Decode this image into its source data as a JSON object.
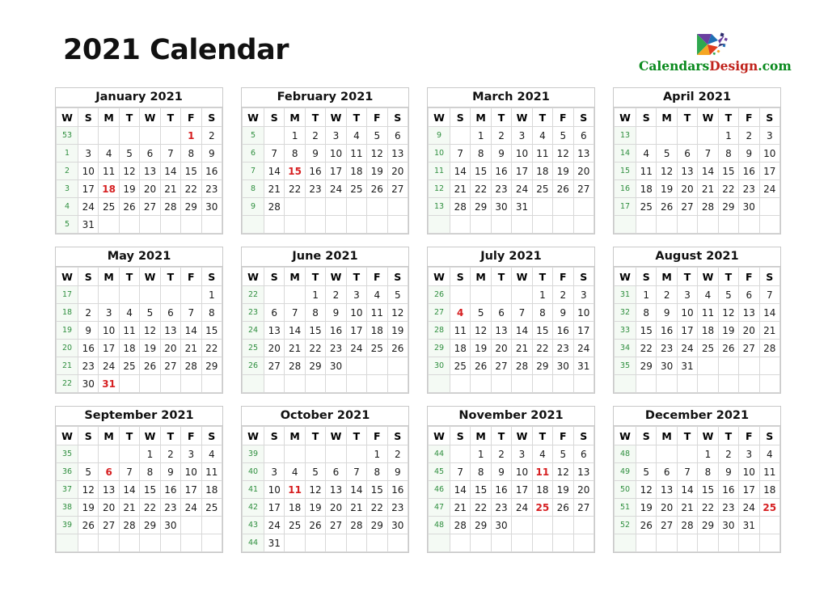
{
  "header": {
    "title": "2021 Calendar",
    "brand": {
      "part1": "Calendars",
      "part2": "Design",
      "part3": ".com",
      "logo_icon": "pinwheel-logo-icon"
    }
  },
  "colors": {
    "holiday": "#d61f21",
    "week_number": "#2f8f3f",
    "week_cell_bg": "#f4faf4",
    "border": "#c9c9c9",
    "text": "#1a1a1a",
    "brand_green": "#0a8a1e",
    "brand_red": "#c0231c"
  },
  "weekday_headers": [
    "W",
    "S",
    "M",
    "T",
    "W",
    "T",
    "F",
    "S"
  ],
  "months": [
    {
      "name": "January 2021",
      "weeks": [
        {
          "no": "53",
          "days": [
            "",
            "",
            "",
            "",
            "",
            "1",
            "2"
          ],
          "holidays": [
            "1"
          ]
        },
        {
          "no": "1",
          "days": [
            "3",
            "4",
            "5",
            "6",
            "7",
            "8",
            "9"
          ],
          "holidays": []
        },
        {
          "no": "2",
          "days": [
            "10",
            "11",
            "12",
            "13",
            "14",
            "15",
            "16"
          ],
          "holidays": []
        },
        {
          "no": "3",
          "days": [
            "17",
            "18",
            "19",
            "20",
            "21",
            "22",
            "23"
          ],
          "holidays": [
            "18"
          ]
        },
        {
          "no": "4",
          "days": [
            "24",
            "25",
            "26",
            "27",
            "28",
            "29",
            "30"
          ],
          "holidays": []
        },
        {
          "no": "5",
          "days": [
            "31",
            "",
            "",
            "",
            "",
            "",
            ""
          ],
          "holidays": []
        }
      ]
    },
    {
      "name": "February 2021",
      "weeks": [
        {
          "no": "5",
          "days": [
            "",
            "1",
            "2",
            "3",
            "4",
            "5",
            "6"
          ],
          "holidays": []
        },
        {
          "no": "6",
          "days": [
            "7",
            "8",
            "9",
            "10",
            "11",
            "12",
            "13"
          ],
          "holidays": []
        },
        {
          "no": "7",
          "days": [
            "14",
            "15",
            "16",
            "17",
            "18",
            "19",
            "20"
          ],
          "holidays": [
            "15"
          ]
        },
        {
          "no": "8",
          "days": [
            "21",
            "22",
            "23",
            "24",
            "25",
            "26",
            "27"
          ],
          "holidays": []
        },
        {
          "no": "9",
          "days": [
            "28",
            "",
            "",
            "",
            "",
            "",
            ""
          ],
          "holidays": []
        },
        {
          "no": "",
          "days": [
            "",
            "",
            "",
            "",
            "",
            "",
            ""
          ],
          "holidays": []
        }
      ]
    },
    {
      "name": "March 2021",
      "weeks": [
        {
          "no": "9",
          "days": [
            "",
            "1",
            "2",
            "3",
            "4",
            "5",
            "6"
          ],
          "holidays": []
        },
        {
          "no": "10",
          "days": [
            "7",
            "8",
            "9",
            "10",
            "11",
            "12",
            "13"
          ],
          "holidays": []
        },
        {
          "no": "11",
          "days": [
            "14",
            "15",
            "16",
            "17",
            "18",
            "19",
            "20"
          ],
          "holidays": []
        },
        {
          "no": "12",
          "days": [
            "21",
            "22",
            "23",
            "24",
            "25",
            "26",
            "27"
          ],
          "holidays": []
        },
        {
          "no": "13",
          "days": [
            "28",
            "29",
            "30",
            "31",
            "",
            "",
            ""
          ],
          "holidays": []
        },
        {
          "no": "",
          "days": [
            "",
            "",
            "",
            "",
            "",
            "",
            ""
          ],
          "holidays": []
        }
      ]
    },
    {
      "name": "April 2021",
      "weeks": [
        {
          "no": "13",
          "days": [
            "",
            "",
            "",
            "",
            "1",
            "2",
            "3"
          ],
          "holidays": []
        },
        {
          "no": "14",
          "days": [
            "4",
            "5",
            "6",
            "7",
            "8",
            "9",
            "10"
          ],
          "holidays": []
        },
        {
          "no": "15",
          "days": [
            "11",
            "12",
            "13",
            "14",
            "15",
            "16",
            "17"
          ],
          "holidays": []
        },
        {
          "no": "16",
          "days": [
            "18",
            "19",
            "20",
            "21",
            "22",
            "23",
            "24"
          ],
          "holidays": []
        },
        {
          "no": "17",
          "days": [
            "25",
            "26",
            "27",
            "28",
            "29",
            "30",
            ""
          ],
          "holidays": []
        },
        {
          "no": "",
          "days": [
            "",
            "",
            "",
            "",
            "",
            "",
            ""
          ],
          "holidays": []
        }
      ]
    },
    {
      "name": "May 2021",
      "weeks": [
        {
          "no": "17",
          "days": [
            "",
            "",
            "",
            "",
            "",
            "",
            "1"
          ],
          "holidays": []
        },
        {
          "no": "18",
          "days": [
            "2",
            "3",
            "4",
            "5",
            "6",
            "7",
            "8"
          ],
          "holidays": []
        },
        {
          "no": "19",
          "days": [
            "9",
            "10",
            "11",
            "12",
            "13",
            "14",
            "15"
          ],
          "holidays": []
        },
        {
          "no": "20",
          "days": [
            "16",
            "17",
            "18",
            "19",
            "20",
            "21",
            "22"
          ],
          "holidays": []
        },
        {
          "no": "21",
          "days": [
            "23",
            "24",
            "25",
            "26",
            "27",
            "28",
            "29"
          ],
          "holidays": []
        },
        {
          "no": "22",
          "days": [
            "30",
            "31",
            "",
            "",
            "",
            "",
            ""
          ],
          "holidays": [
            "31"
          ]
        }
      ]
    },
    {
      "name": "June 2021",
      "weeks": [
        {
          "no": "22",
          "days": [
            "",
            "",
            "1",
            "2",
            "3",
            "4",
            "5"
          ],
          "holidays": []
        },
        {
          "no": "23",
          "days": [
            "6",
            "7",
            "8",
            "9",
            "10",
            "11",
            "12"
          ],
          "holidays": []
        },
        {
          "no": "24",
          "days": [
            "13",
            "14",
            "15",
            "16",
            "17",
            "18",
            "19"
          ],
          "holidays": []
        },
        {
          "no": "25",
          "days": [
            "20",
            "21",
            "22",
            "23",
            "24",
            "25",
            "26"
          ],
          "holidays": []
        },
        {
          "no": "26",
          "days": [
            "27",
            "28",
            "29",
            "30",
            "",
            "",
            ""
          ],
          "holidays": []
        },
        {
          "no": "",
          "days": [
            "",
            "",
            "",
            "",
            "",
            "",
            ""
          ],
          "holidays": []
        }
      ]
    },
    {
      "name": "July 2021",
      "weeks": [
        {
          "no": "26",
          "days": [
            "",
            "",
            "",
            "",
            "1",
            "2",
            "3"
          ],
          "holidays": []
        },
        {
          "no": "27",
          "days": [
            "4",
            "5",
            "6",
            "7",
            "8",
            "9",
            "10"
          ],
          "holidays": [
            "4"
          ]
        },
        {
          "no": "28",
          "days": [
            "11",
            "12",
            "13",
            "14",
            "15",
            "16",
            "17"
          ],
          "holidays": []
        },
        {
          "no": "29",
          "days": [
            "18",
            "19",
            "20",
            "21",
            "22",
            "23",
            "24"
          ],
          "holidays": []
        },
        {
          "no": "30",
          "days": [
            "25",
            "26",
            "27",
            "28",
            "29",
            "30",
            "31"
          ],
          "holidays": []
        },
        {
          "no": "",
          "days": [
            "",
            "",
            "",
            "",
            "",
            "",
            ""
          ],
          "holidays": []
        }
      ]
    },
    {
      "name": "August 2021",
      "weeks": [
        {
          "no": "31",
          "days": [
            "1",
            "2",
            "3",
            "4",
            "5",
            "6",
            "7"
          ],
          "holidays": []
        },
        {
          "no": "32",
          "days": [
            "8",
            "9",
            "10",
            "11",
            "12",
            "13",
            "14"
          ],
          "holidays": []
        },
        {
          "no": "33",
          "days": [
            "15",
            "16",
            "17",
            "18",
            "19",
            "20",
            "21"
          ],
          "holidays": []
        },
        {
          "no": "34",
          "days": [
            "22",
            "23",
            "24",
            "25",
            "26",
            "27",
            "28"
          ],
          "holidays": []
        },
        {
          "no": "35",
          "days": [
            "29",
            "30",
            "31",
            "",
            "",
            "",
            ""
          ],
          "holidays": []
        },
        {
          "no": "",
          "days": [
            "",
            "",
            "",
            "",
            "",
            "",
            ""
          ],
          "holidays": []
        }
      ]
    },
    {
      "name": "September 2021",
      "weeks": [
        {
          "no": "35",
          "days": [
            "",
            "",
            "",
            "1",
            "2",
            "3",
            "4"
          ],
          "holidays": []
        },
        {
          "no": "36",
          "days": [
            "5",
            "6",
            "7",
            "8",
            "9",
            "10",
            "11"
          ],
          "holidays": [
            "6"
          ]
        },
        {
          "no": "37",
          "days": [
            "12",
            "13",
            "14",
            "15",
            "16",
            "17",
            "18"
          ],
          "holidays": []
        },
        {
          "no": "38",
          "days": [
            "19",
            "20",
            "21",
            "22",
            "23",
            "24",
            "25"
          ],
          "holidays": []
        },
        {
          "no": "39",
          "days": [
            "26",
            "27",
            "28",
            "29",
            "30",
            "",
            ""
          ],
          "holidays": []
        },
        {
          "no": "",
          "days": [
            "",
            "",
            "",
            "",
            "",
            "",
            ""
          ],
          "holidays": []
        }
      ]
    },
    {
      "name": "October 2021",
      "weeks": [
        {
          "no": "39",
          "days": [
            "",
            "",
            "",
            "",
            "",
            "1",
            "2"
          ],
          "holidays": []
        },
        {
          "no": "40",
          "days": [
            "3",
            "4",
            "5",
            "6",
            "7",
            "8",
            "9"
          ],
          "holidays": []
        },
        {
          "no": "41",
          "days": [
            "10",
            "11",
            "12",
            "13",
            "14",
            "15",
            "16"
          ],
          "holidays": [
            "11"
          ]
        },
        {
          "no": "42",
          "days": [
            "17",
            "18",
            "19",
            "20",
            "21",
            "22",
            "23"
          ],
          "holidays": []
        },
        {
          "no": "43",
          "days": [
            "24",
            "25",
            "26",
            "27",
            "28",
            "29",
            "30"
          ],
          "holidays": []
        },
        {
          "no": "44",
          "days": [
            "31",
            "",
            "",
            "",
            "",
            "",
            ""
          ],
          "holidays": []
        }
      ]
    },
    {
      "name": "November 2021",
      "weeks": [
        {
          "no": "44",
          "days": [
            "",
            "1",
            "2",
            "3",
            "4",
            "5",
            "6"
          ],
          "holidays": []
        },
        {
          "no": "45",
          "days": [
            "7",
            "8",
            "9",
            "10",
            "11",
            "12",
            "13"
          ],
          "holidays": [
            "11"
          ]
        },
        {
          "no": "46",
          "days": [
            "14",
            "15",
            "16",
            "17",
            "18",
            "19",
            "20"
          ],
          "holidays": []
        },
        {
          "no": "47",
          "days": [
            "21",
            "22",
            "23",
            "24",
            "25",
            "26",
            "27"
          ],
          "holidays": [
            "25"
          ]
        },
        {
          "no": "48",
          "days": [
            "28",
            "29",
            "30",
            "",
            "",
            "",
            ""
          ],
          "holidays": []
        },
        {
          "no": "",
          "days": [
            "",
            "",
            "",
            "",
            "",
            "",
            ""
          ],
          "holidays": []
        }
      ]
    },
    {
      "name": "December 2021",
      "weeks": [
        {
          "no": "48",
          "days": [
            "",
            "",
            "",
            "1",
            "2",
            "3",
            "4"
          ],
          "holidays": []
        },
        {
          "no": "49",
          "days": [
            "5",
            "6",
            "7",
            "8",
            "9",
            "10",
            "11"
          ],
          "holidays": []
        },
        {
          "no": "50",
          "days": [
            "12",
            "13",
            "14",
            "15",
            "16",
            "17",
            "18"
          ],
          "holidays": []
        },
        {
          "no": "51",
          "days": [
            "19",
            "20",
            "21",
            "22",
            "23",
            "24",
            "25"
          ],
          "holidays": [
            "25"
          ]
        },
        {
          "no": "52",
          "days": [
            "26",
            "27",
            "28",
            "29",
            "30",
            "31",
            ""
          ],
          "holidays": []
        },
        {
          "no": "",
          "days": [
            "",
            "",
            "",
            "",
            "",
            "",
            ""
          ],
          "holidays": []
        }
      ]
    }
  ]
}
